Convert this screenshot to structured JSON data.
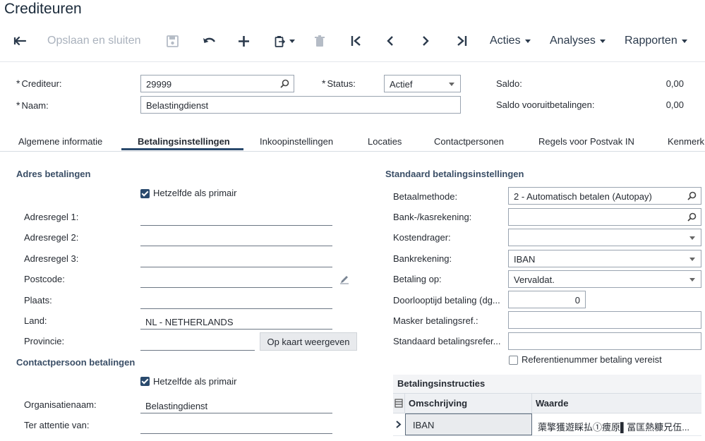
{
  "page": {
    "title": "Crediteuren"
  },
  "toolbar": {
    "save_close_label": "Opslaan en sluiten",
    "actions_label": "Acties",
    "analyses_label": "Analyses",
    "reports_label": "Rapporten"
  },
  "header": {
    "vendor_label": "Crediteur:",
    "vendor_value": "29999",
    "name_label": "Naam:",
    "name_value": "Belastingdienst",
    "status_label": "Status:",
    "status_value": "Actief",
    "balance_label": "Saldo:",
    "balance_value": "0,00",
    "prepay_balance_label": "Saldo vooruitbetalingen:",
    "prepay_balance_value": "0,00",
    "required_mark": "*"
  },
  "tabs": [
    {
      "label": "Algemene informatie"
    },
    {
      "label": "Betalingsinstellingen"
    },
    {
      "label": "Inkoopinstellingen"
    },
    {
      "label": "Locaties"
    },
    {
      "label": "Contactpersonen"
    },
    {
      "label": "Regels voor Postvak IN"
    },
    {
      "label": "Kenmerk"
    }
  ],
  "payment_address": {
    "title": "Adres betalingen",
    "same_as_primary": "Hetzelfde als primair",
    "address1_label": "Adresregel 1:",
    "address1_value": "",
    "address2_label": "Adresregel 2:",
    "address2_value": "",
    "address3_label": "Adresregel 3:",
    "address3_value": "",
    "postcode_label": "Postcode:",
    "postcode_value": "",
    "city_label": "Plaats:",
    "city_value": "",
    "country_label": "Land:",
    "country_value": "NL - NETHERLANDS",
    "province_label": "Provincie:",
    "province_value": "",
    "map_button": "Op kaart weergeven"
  },
  "payment_contact": {
    "title": "Contactpersoon betalingen",
    "same_as_primary": "Hetzelfde als primair",
    "org_label": "Organisatienaam:",
    "org_value": "Belastingdienst",
    "attention_label": "Ter attentie van:",
    "attention_value": ""
  },
  "default_payment": {
    "title": "Standaard betalingsinstellingen",
    "method_label": "Betaalmethode:",
    "method_value": "2 - Automatisch betalen (Autopay)",
    "cash_account_label": "Bank-/kasrekening:",
    "cash_account_value": "",
    "cost_bearer_label": "Kostendrager:",
    "cost_bearer_value": "",
    "bank_account_label": "Bankrekening:",
    "bank_account_value": "IBAN",
    "pay_by_label": "Betaling op:",
    "pay_by_value": "Vervaldat.",
    "lead_time_label": "Doorlooptijd betaling (dg...",
    "lead_time_value": "0",
    "mask_label": "Masker betalingsref.:",
    "mask_value": "",
    "std_ref_label": "Standaard betalingsrefer...",
    "std_ref_value": "",
    "ref_required_label": "Referentienummer betaling vereist"
  },
  "payment_instructions": {
    "title": "Betalingsinstructies",
    "columns": [
      "Omschrijving",
      "Waarde"
    ],
    "rows": [
      {
        "description": "IBAN",
        "value": "蕖擎獲遊睬払①痩原▌冨匡熱糠兄伍..."
      }
    ]
  }
}
